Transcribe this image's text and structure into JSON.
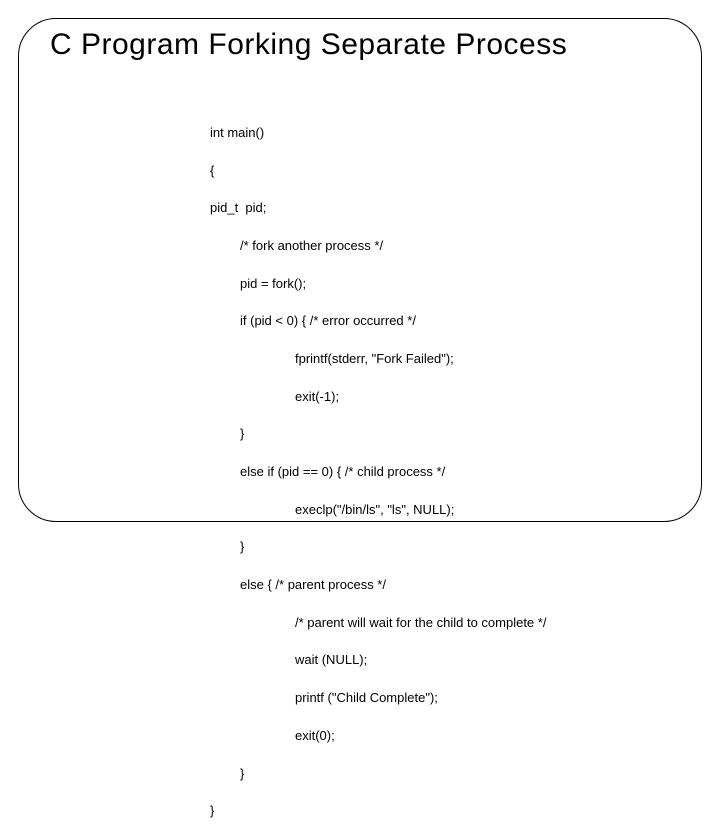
{
  "title": "C Program Forking Separate Process",
  "code": {
    "l0": "int main()",
    "l1": "{",
    "l2": "pid_t  pid;",
    "l3": "/* fork another process */",
    "l4": "pid = fork();",
    "l5": "if (pid < 0) { /* error occurred */",
    "l6": "fprintf(stderr, \"Fork Failed\");",
    "l7": "exit(-1);",
    "l8": "}",
    "l9": "else if (pid == 0) { /* child process */",
    "l10": "execlp(\"/bin/ls\", \"ls\", NULL);",
    "l11": "}",
    "l12": "else { /* parent process */",
    "l13": "/* parent will wait for the child to complete */",
    "l14": "wait (NULL);",
    "l15": "printf (\"Child Complete\");",
    "l16": "exit(0);",
    "l17": "}",
    "l18": "}"
  }
}
